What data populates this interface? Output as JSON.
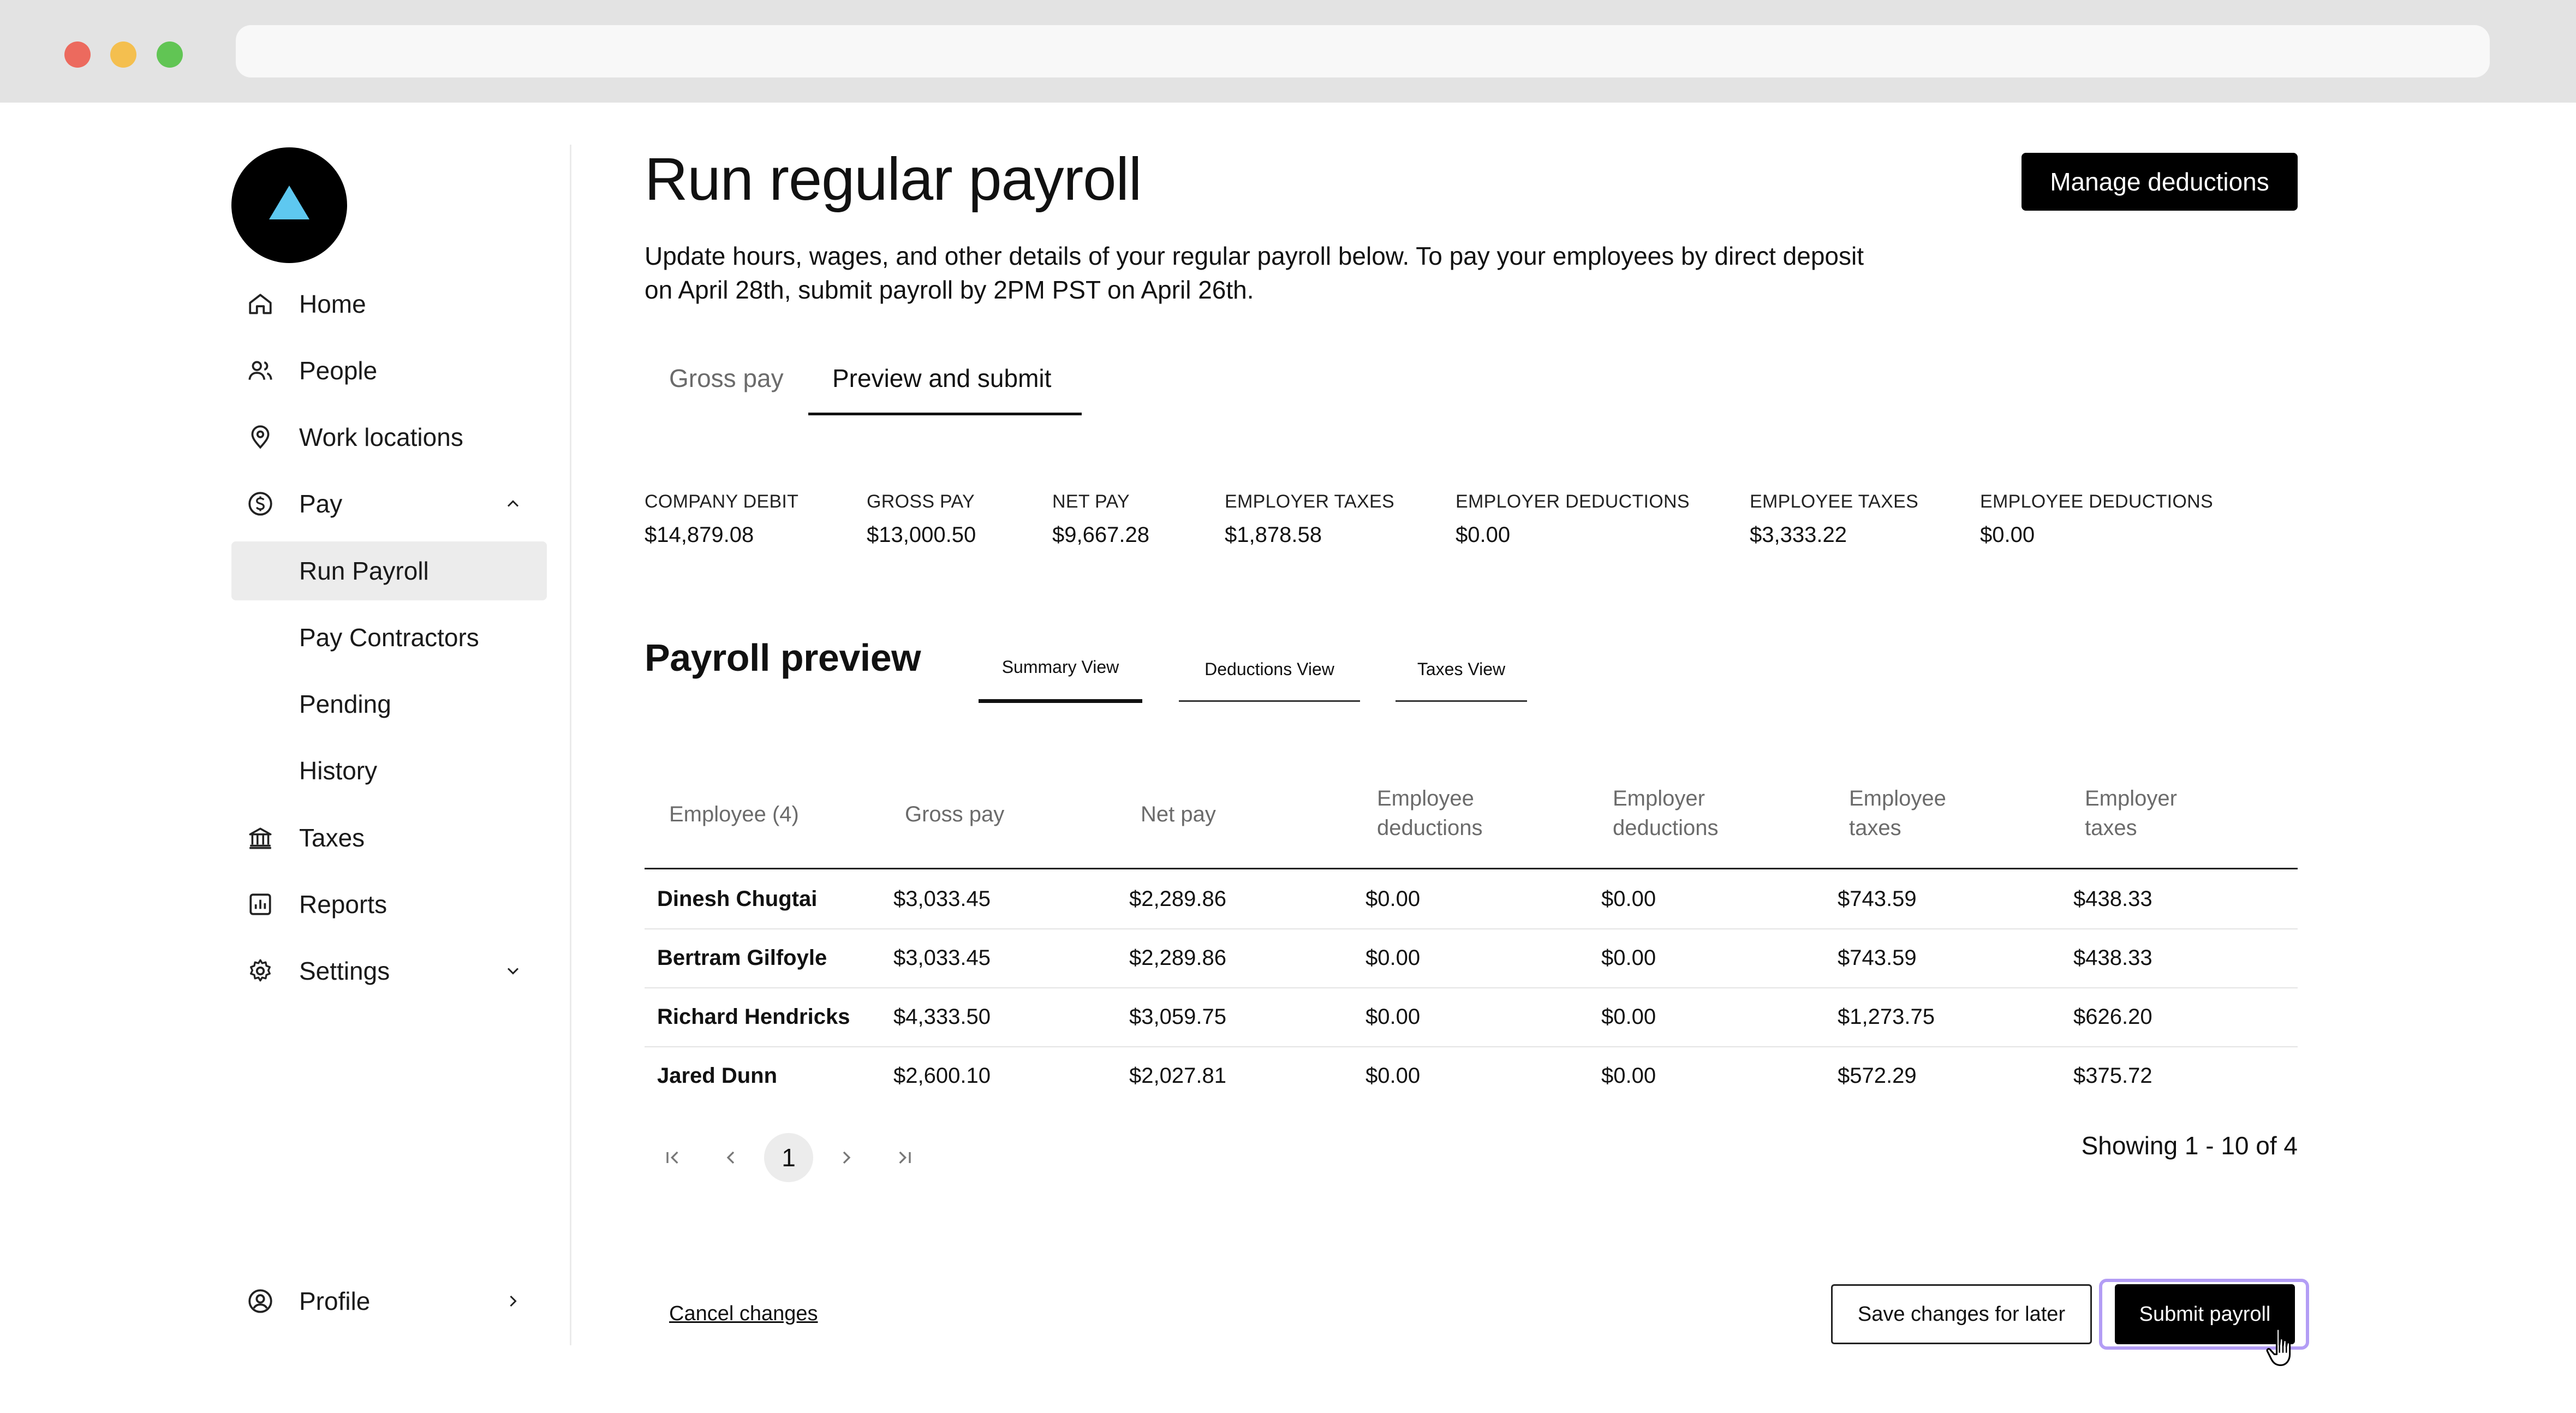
{
  "window": {
    "traffic_lights": [
      "#ec6a5e",
      "#f4bf4f",
      "#61c554"
    ]
  },
  "sidebar": {
    "logo": "triangle-logo",
    "items": [
      {
        "label": "Home",
        "icon": "home-icon"
      },
      {
        "label": "People",
        "icon": "people-icon"
      },
      {
        "label": "Work locations",
        "icon": "location-pin-icon"
      },
      {
        "label": "Pay",
        "icon": "dollar-circle-icon",
        "expanded": true
      },
      {
        "label": "Run Payroll",
        "active": true
      },
      {
        "label": "Pay Contractors"
      },
      {
        "label": "Pending"
      },
      {
        "label": "History"
      },
      {
        "label": "Taxes",
        "icon": "bank-icon"
      },
      {
        "label": "Reports",
        "icon": "chart-icon"
      },
      {
        "label": "Settings",
        "icon": "gear-icon",
        "expanded": false
      }
    ],
    "profile": {
      "label": "Profile",
      "icon": "user-circle-icon"
    }
  },
  "header": {
    "title": "Run regular payroll",
    "description": "Update hours, wages, and other details of your regular payroll below. To pay your employees by direct deposit on April 28th, submit payroll by 2PM PST on April 26th.",
    "manage_button": "Manage deductions"
  },
  "tabs": [
    {
      "label": "Gross pay",
      "active": false
    },
    {
      "label": "Preview and submit",
      "active": true
    }
  ],
  "summary": [
    {
      "label": "COMPANY DEBIT",
      "value": "$14,879.08"
    },
    {
      "label": "GROSS PAY",
      "value": "$13,000.50"
    },
    {
      "label": "NET PAY",
      "value": "$9,667.28"
    },
    {
      "label": "EMPLOYER TAXES",
      "value": "$1,878.58"
    },
    {
      "label": "EMPLOYER DEDUCTIONS",
      "value": "$0.00"
    },
    {
      "label": "EMPLOYEE TAXES",
      "value": "$3,333.22"
    },
    {
      "label": "EMPLOYEE DEDUCTIONS",
      "value": "$0.00"
    }
  ],
  "preview": {
    "title": "Payroll preview",
    "views": [
      {
        "label": "Summary View",
        "active": true
      },
      {
        "label": "Deductions View",
        "active": false
      },
      {
        "label": "Taxes View",
        "active": false
      }
    ],
    "columns": [
      {
        "line1": "Employee (4)",
        "line2": ""
      },
      {
        "line1": "Gross pay",
        "line2": ""
      },
      {
        "line1": "Net pay",
        "line2": ""
      },
      {
        "line1": "Employee",
        "line2": "deductions"
      },
      {
        "line1": "Employer",
        "line2": "deductions"
      },
      {
        "line1": "Employee",
        "line2": "taxes"
      },
      {
        "line1": "Employer",
        "line2": "taxes"
      }
    ],
    "rows": [
      [
        "Dinesh Chugtai",
        "$3,033.45",
        "$2,289.86",
        "$0.00",
        "$0.00",
        "$743.59",
        "$438.33"
      ],
      [
        "Bertram Gilfoyle",
        "$3,033.45",
        "$2,289.86",
        "$0.00",
        "$0.00",
        "$743.59",
        "$438.33"
      ],
      [
        "Richard Hendricks",
        "$4,333.50",
        "$3,059.75",
        "$0.00",
        "$0.00",
        "$1,273.75",
        "$626.20"
      ],
      [
        "Jared Dunn",
        "$2,600.10",
        "$2,027.81",
        "$0.00",
        "$0.00",
        "$572.29",
        "$375.72"
      ]
    ]
  },
  "pagination": {
    "current_page": "1",
    "showing": "Showing 1 - 10 of 4"
  },
  "footer": {
    "cancel": "Cancel changes",
    "save": "Save changes for later",
    "submit": "Submit payroll",
    "focus_ring_color": "#b39df5"
  }
}
